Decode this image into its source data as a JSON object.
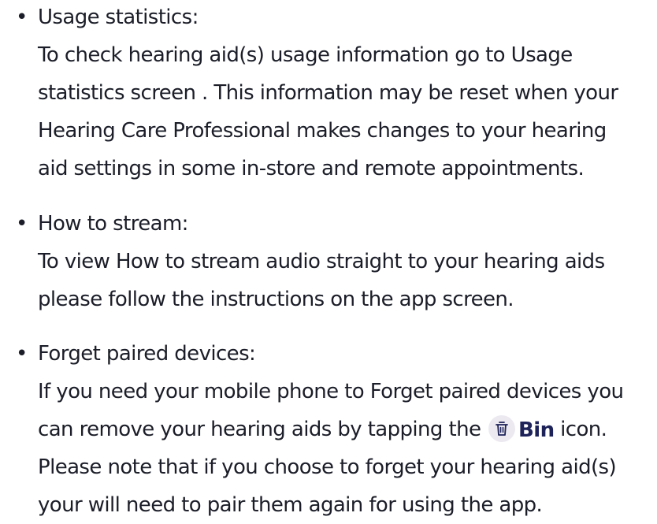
{
  "items": [
    {
      "heading": "Usage statistics:",
      "lines": [
        "To check hearing aid(s) usage information go to Usage",
        "statistics screen . This information may be reset when your",
        "Hearing Care Professional makes changes to your hearing",
        "aid settings in some in-store and remote appointments."
      ]
    },
    {
      "heading": "How to stream:",
      "lines": [
        "To view How to stream audio straight to your hearing aids",
        "please follow the instructions on the app screen."
      ]
    },
    {
      "heading": "Forget paired devices:",
      "lines": [
        "If you need your mobile phone to Forget paired devices you",
        "can remove your hearing aids by tapping the",
        "Please note that if you choose to forget your hearing aid(s)",
        "your will need to pair them again for using the app."
      ],
      "inline_icon": {
        "icon": "bin-icon",
        "label": "Bin",
        "suffix": " icon."
      }
    }
  ],
  "bullet_char": "•",
  "colors": {
    "text": "#1b1d28",
    "bin_label": "#1d2259",
    "icon_bg": "#eceaf0"
  }
}
